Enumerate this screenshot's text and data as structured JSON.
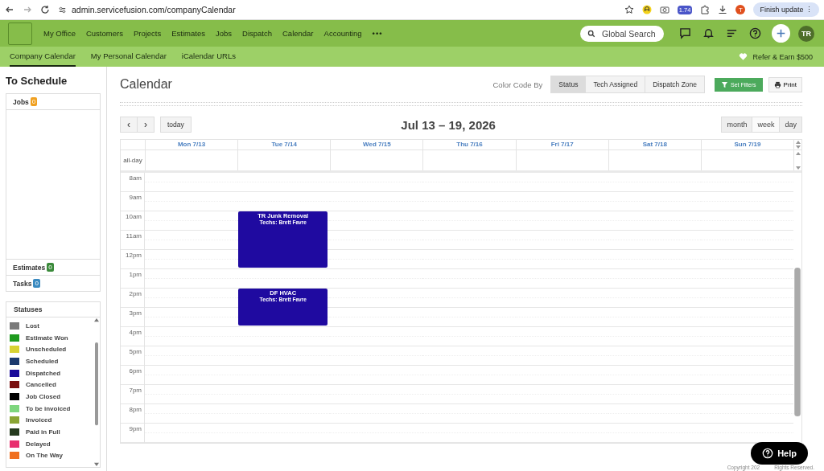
{
  "browser": {
    "url": "admin.servicefusion.com/companyCalendar",
    "extension_badge": "1.74",
    "profile_initial": "T",
    "update_button": "Finish update ⋮"
  },
  "nav": {
    "items": [
      "My Office",
      "Customers",
      "Projects",
      "Estimates",
      "Jobs",
      "Dispatch",
      "Calendar",
      "Accounting"
    ],
    "more": "•••",
    "search": {
      "placeholder": "Global Search"
    },
    "avatar": "TR"
  },
  "subnav": {
    "tabs": [
      {
        "label": "Company Calendar",
        "selected": true
      },
      {
        "label": "My Personal Calendar",
        "selected": false
      },
      {
        "label": "iCalendar URLs",
        "selected": false
      }
    ],
    "promo": "Refer & Earn $500"
  },
  "sidebar": {
    "title": "To Schedule",
    "sections": [
      {
        "label": "Jobs",
        "count": "0",
        "color": "#f0a020"
      },
      {
        "label": "Estimates",
        "count": "0",
        "color": "#3a8a3a"
      },
      {
        "label": "Tasks",
        "count": "0",
        "color": "#3a8ac0"
      }
    ],
    "statuses": {
      "title": "Statuses",
      "items": [
        {
          "label": "Lost",
          "color": "#7a7a7a"
        },
        {
          "label": "Estimate Won",
          "color": "#1e9a1e"
        },
        {
          "label": "Unscheduled",
          "color": "#d8d232"
        },
        {
          "label": "Scheduled",
          "color": "#1c3a6e"
        },
        {
          "label": "Dispatched",
          "color": "#1a0a9a"
        },
        {
          "label": "Cancelled",
          "color": "#7a1010"
        },
        {
          "label": "Job Closed",
          "color": "#000000"
        },
        {
          "label": "To be invoiced",
          "color": "#7ed67e"
        },
        {
          "label": "Invoiced",
          "color": "#8aa534"
        },
        {
          "label": "Paid in Full",
          "color": "#253a1e"
        },
        {
          "label": "Delayed",
          "color": "#e8306e"
        },
        {
          "label": "On The Way",
          "color": "#f07020"
        }
      ]
    }
  },
  "calendar": {
    "title": "Calendar",
    "color_code_label": "Color Code By",
    "color_code_options": [
      {
        "label": "Status",
        "selected": true
      },
      {
        "label": "Tech Assigned",
        "selected": false
      },
      {
        "label": "Dispatch Zone",
        "selected": false
      }
    ],
    "filters_button": "Set Filters",
    "print_button": "Print",
    "prev": "‹",
    "next": "›",
    "today_button": "today",
    "range": "Jul 13 – 19, 2026",
    "views": [
      {
        "label": "month",
        "selected": false
      },
      {
        "label": "week",
        "selected": true
      },
      {
        "label": "day",
        "selected": false
      }
    ],
    "all_day_label": "all-day",
    "days": [
      {
        "label": "Mon 7/13"
      },
      {
        "label": "Tue 7/14",
        "slots": [
          {
            "busy": false
          },
          {
            "busy": false
          },
          {
            "busy": true
          },
          {
            "busy": true
          },
          {
            "busy": true
          },
          {
            "busy": false
          },
          {
            "busy": true
          },
          {
            "busy": true
          },
          {
            "busy": false
          },
          {
            "busy": false
          },
          {
            "busy": false
          },
          {
            "busy": false
          },
          {
            "busy": false
          },
          {
            "busy": false
          }
        ],
        "events": [
          {
            "title": "TR Junk Removal",
            "techs_label": "Techs:",
            "techs": "Brett Favre",
            "color": "#1f0aa0"
          },
          {
            "title": "DF HVAC",
            "techs_label": "Techs:",
            "techs": "Brett Favre",
            "color": "#1f0aa0"
          }
        ]
      },
      {
        "label": "Wed 7/15"
      },
      {
        "label": "Thu 7/16"
      },
      {
        "label": "Fri 7/17"
      },
      {
        "label": "Sat 7/18"
      },
      {
        "label": "Sun 7/19"
      }
    ],
    "hours": [
      {
        "label": "8am"
      },
      {
        "label": "9am"
      },
      {
        "label": "10am"
      },
      {
        "label": "11am"
      },
      {
        "label": "12pm"
      },
      {
        "label": "1pm"
      },
      {
        "label": "2pm"
      },
      {
        "label": "3pm"
      },
      {
        "label": "4pm"
      },
      {
        "label": "5pm"
      },
      {
        "label": "6pm"
      },
      {
        "label": "7pm"
      },
      {
        "label": "8pm"
      },
      {
        "label": "9pm"
      }
    ]
  },
  "help_button": "Help",
  "footer": [
    "Copyright 202",
    "Rights Reserved."
  ]
}
